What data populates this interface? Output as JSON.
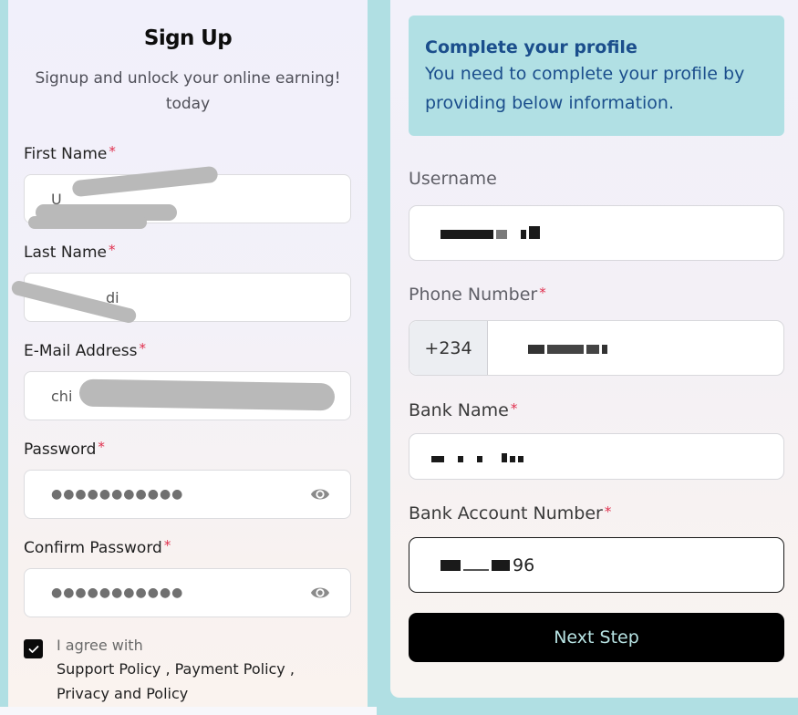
{
  "colors": {
    "page_bg": "#b0dfe3",
    "required_asterisk": "#e0304e",
    "alert_bg": "#b1e0e4",
    "alert_text": "#1b4e8c",
    "button_bg": "#000000",
    "button_text": "#b7e3e3"
  },
  "signup": {
    "title": "Sign Up",
    "subtitle": "Signup and unlock your online earning! today",
    "required_mark": "*",
    "fields": {
      "first_name": {
        "label": "First Name",
        "value": "U"
      },
      "last_name": {
        "label": "Last Name",
        "value": "di"
      },
      "email": {
        "label": "E-Mail Address",
        "value": "chi"
      },
      "password": {
        "label": "Password",
        "value": "●●●●●●●●●●●",
        "icon": "eye-icon"
      },
      "confirm_password": {
        "label": "Confirm Password",
        "value": "●●●●●●●●●●●",
        "icon": "eye-icon"
      }
    },
    "agree": {
      "checked": true,
      "text": "I agree with",
      "policy_line_1": "Support Policy , Payment Policy ,",
      "policy_line_2": "Privacy and Policy"
    }
  },
  "profile": {
    "alert": {
      "title": "Complete your profile",
      "body": "You need to complete your profile by providing below information."
    },
    "required_mark": "*",
    "fields": {
      "username": {
        "label": "Username",
        "value": "[redacted]"
      },
      "phone": {
        "label": "Phone Number",
        "prefix": "+234",
        "value": "[redacted]"
      },
      "bank_name": {
        "label": "Bank Name",
        "value": "[redacted]"
      },
      "bank_account": {
        "label": "Bank Account Number",
        "value_suffix": "96"
      }
    },
    "next_button": "Next Step"
  }
}
